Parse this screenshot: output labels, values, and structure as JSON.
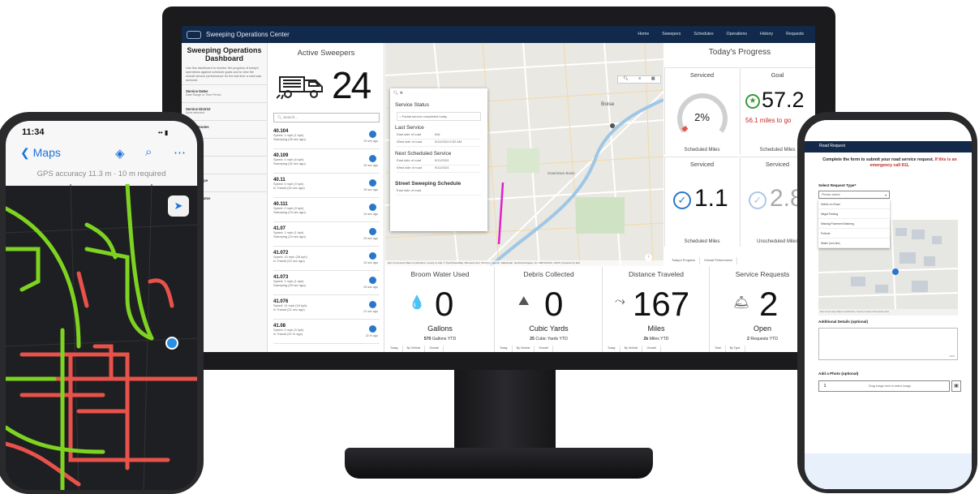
{
  "dashboard": {
    "app_title": "Sweeping Operations Center",
    "nav": [
      "Home",
      "Sweepers",
      "Schedules",
      "Operations",
      "History",
      "Requests"
    ],
    "active_nav": "Operations",
    "left_title": "Sweeping Operations Dashboard",
    "left_description": "Use this dashboard to monitor the progress of today's operations against schedule goals and to view the overall service performance for the last time a road was serviced.",
    "filters": [
      {
        "label": "Service Dates",
        "sub": "Date Range or Time Period"
      },
      {
        "label": "Service District",
        "sub": "None selected"
      },
      {
        "label": "Sweep Routes",
        "sub": ""
      },
      {
        "label": "Road",
        "sub": ""
      },
      {
        "label": "Sweeper",
        "sub": ""
      },
      {
        "label": "Request Type",
        "sub": ""
      },
      {
        "label": "Request Status",
        "sub": ""
      }
    ],
    "active_sweepers": {
      "title": "Active Sweepers",
      "count": "24",
      "search_placeholder": "Search...",
      "list": [
        {
          "id": "40.104",
          "l1": "Speed: 1 mph (1 kph)",
          "l2": "Sweeping (28 sec ago)",
          "ago": "29 sec ago"
        },
        {
          "id": "40.109",
          "l1": "Speed: 4 mph (6 kph)",
          "l2": "Sweeping (32 sec ago)",
          "ago": "32 sec ago"
        },
        {
          "id": "40.11",
          "l1": "Speed: 0 mph (0 kph)",
          "l2": "In Transit (34 sec ago)",
          "ago": "34 sec ago"
        },
        {
          "id": "40.111",
          "l1": "Speed: 0 mph (0 kph)",
          "l2": "Sweeping (24 sec ago)",
          "ago": "24 sec ago"
        },
        {
          "id": "41.07",
          "l1": "Speed: 1 mph (1 kph)",
          "l2": "Sweeping (24 sec ago)",
          "ago": "24 sec ago"
        },
        {
          "id": "41.072",
          "l1": "Speed: 10 mph (28 kph)",
          "l2": "In Transit (24 sec ago)",
          "ago": "24 sec ago"
        },
        {
          "id": "41.073",
          "l1": "Speed: 1 mph (1 kph)",
          "l2": "Sweeping (25 sec ago)",
          "ago": "25 sec ago"
        },
        {
          "id": "41.076",
          "l1": "Speed: 11 mph (18 kph)",
          "l2": "In Transit (21 sec ago)",
          "ago": "21 sec ago"
        },
        {
          "id": "41.08",
          "l1": "Speed: 0 mph (0 kph)",
          "l2": "In Transit (22 hr ago)",
          "ago": "22 hr ago"
        }
      ]
    },
    "map": {
      "city_label": "Boise",
      "downtown_label": "Downtown Boise",
      "popup": {
        "service_status": "Service Status",
        "status_text": "Partial service completed today",
        "last_service": "Last Service",
        "last_rows": [
          [
            "East side of road",
            "N/A"
          ],
          [
            "West side of road",
            "9/11/2024 6:52 AM"
          ]
        ],
        "next_service": "Next Scheduled Service",
        "next_rows": [
          [
            "East side of road",
            "9/11/2024"
          ],
          [
            "West side of road",
            "9/11/2024"
          ]
        ],
        "schedule_title": "Street Sweeping Schedule",
        "schedule_row": "East side of road"
      },
      "attribution": "Esri Community Maps Contributors, County of Ada, © OpenStreetMap, Microsoft, Esri, TomTom, Garmin, SafeGraph, GeoTechnologies, Inc, METI/NASA, USGS | Powered by Esri"
    },
    "progress": {
      "title": "Today's Progress",
      "serviced_label": "Serviced",
      "serviced_pct": "2%",
      "serviced_pct_value": 2,
      "serviced_footer": "Scheduled Miles",
      "goal_label": "Goal",
      "goal_value": "57.2",
      "goal_note": "56.1 miles to go",
      "goal_footer": "Scheduled Miles",
      "serviced2_label": "Serviced",
      "serviced2_value": "1.1",
      "serviced2_footer": "Scheduled Miles",
      "serviced3_label": "Serviced",
      "serviced3_value": "2.8",
      "serviced3_footer": "Unscheduled Miles",
      "tabs": [
        "Today's Progress",
        "Overall Performance"
      ]
    },
    "kpis": [
      {
        "title": "Broom Water Used",
        "value": "0",
        "unit": "Gallons",
        "ytd_bold": "570",
        "ytd_rest": " Gallons YTD",
        "tabs": [
          "Today",
          "By Vehicle",
          "Overall"
        ]
      },
      {
        "title": "Debris Collected",
        "value": "0",
        "unit": "Cubic Yards",
        "ytd_bold": "25",
        "ytd_rest": " Cubic Yards YTD",
        "tabs": [
          "Today",
          "By Vehicle",
          "Overall"
        ]
      },
      {
        "title": "Distance Traveled",
        "value": "167",
        "unit": "Miles",
        "ytd_bold": "2k",
        "ytd_rest": " Miles YTD",
        "tabs": [
          "Today",
          "By Vehicle",
          "Overall"
        ]
      },
      {
        "title": "Service Requests",
        "value": "2",
        "unit": "Open",
        "ytd_bold": "2",
        "ytd_rest": " Requests YTD",
        "tabs": [
          "Total",
          "By Type"
        ]
      }
    ]
  },
  "phone_left": {
    "time": "11:34",
    "back_label": "Maps",
    "gps_text": "GPS accuracy 11.3 m · 10 m required"
  },
  "phone_right": {
    "header": "Road Request",
    "instructions": "Complete the form to submit your road service request.",
    "emergency": "If this is an emergency call 911.",
    "request_type_label": "Select Request Type*",
    "request_type_placeholder": "Please select",
    "options": [
      "Debris on Road",
      "Illegal Parking",
      "Missing Pavement Marking",
      "Pothole",
      "Water (non-fire)"
    ],
    "map_attr": "Esri Community Maps Contributors, County of Ada | Powered by Esri",
    "details_label": "Additional Details (optional)",
    "details_counter": "4000",
    "photo_label": "Add a Photo (optional)",
    "photo_hint": "Drag image here to select image",
    "photo_count": "1"
  },
  "colors": {
    "nav": "#11294a",
    "accent": "#2a77c9",
    "serviced_road": "#7ed321",
    "unserviced_road": "#e8524a",
    "alert": "#c62828"
  }
}
